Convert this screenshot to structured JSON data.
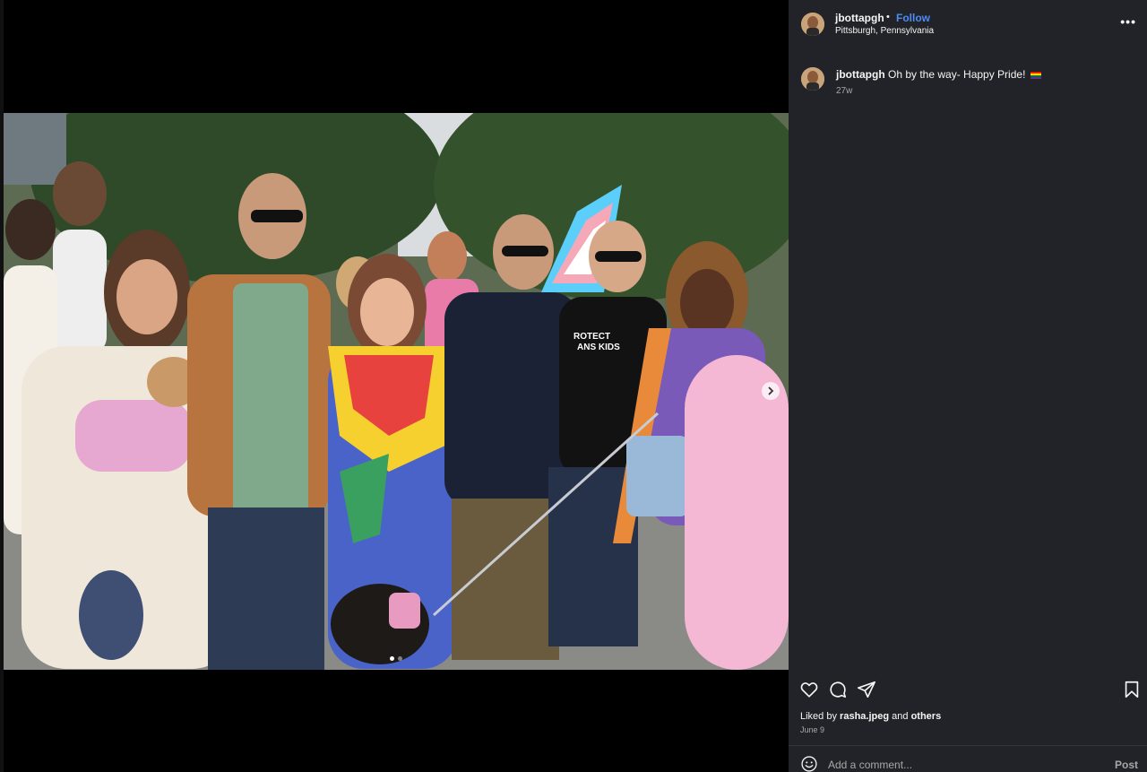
{
  "post": {
    "username": "jbottapgh",
    "separator": "•",
    "follow_label": "Follow",
    "location": "Pittsburgh, Pennsylvania",
    "more_label": "•••"
  },
  "caption": {
    "username": "jbottapgh",
    "text": "Oh by the way- Happy Pride!",
    "flag_icon": "rainbow-flag-icon",
    "time": "27w"
  },
  "media": {
    "image_count": 2,
    "active_index": 0,
    "shirt_text_1": "ROTECT",
    "shirt_text_2": "ANS KIDS"
  },
  "actions": {
    "icons": [
      "heart-icon",
      "comment-icon",
      "share-icon",
      "bookmark-icon"
    ]
  },
  "likes": {
    "prefix": "Liked by",
    "user": "rasha.jpeg",
    "conjunction": "and",
    "others": "others"
  },
  "date": "June 9",
  "comment": {
    "placeholder": "Add a comment...",
    "post_label": "Post"
  }
}
